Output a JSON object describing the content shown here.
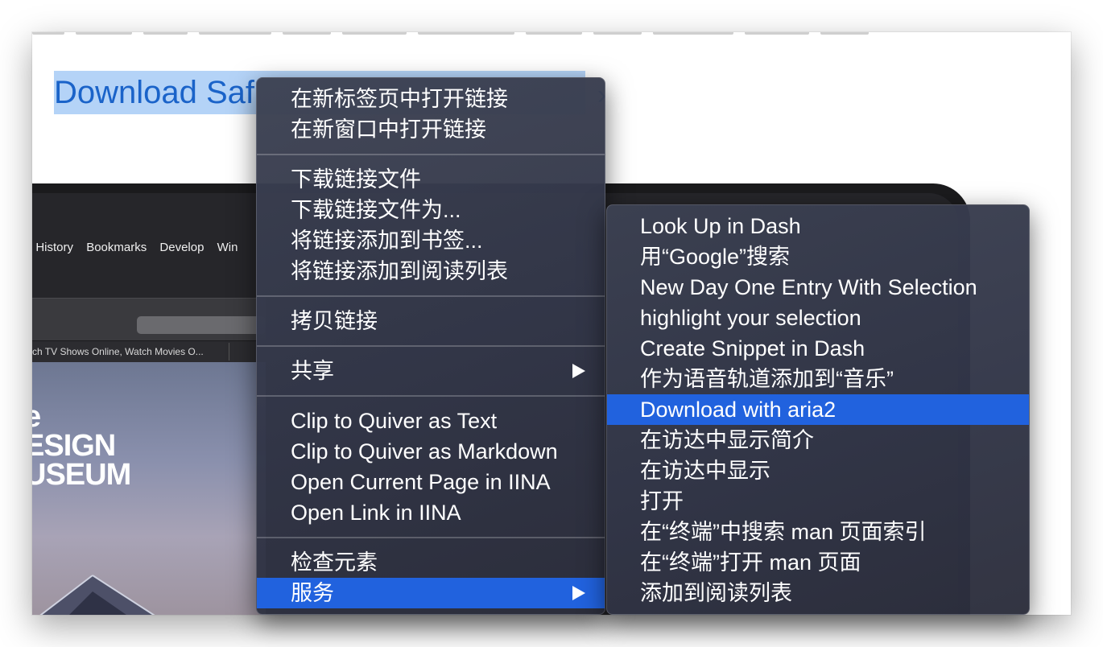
{
  "page": {
    "link_text": "Download Saf",
    "link_chevron": "›"
  },
  "laptop": {
    "menubar": [
      "History",
      "Bookmarks",
      "Develop",
      "Win"
    ],
    "tab_title": "atch TV Shows Online, Watch Movies O...",
    "logo_lines": [
      "e",
      "ESIGN",
      "USEUM"
    ]
  },
  "context_menu": {
    "items": [
      {
        "label": "在新标签页中打开链接"
      },
      {
        "label": "在新窗口中打开链接"
      },
      {
        "label": "下载链接文件"
      },
      {
        "label": "下载链接文件为..."
      },
      {
        "label": "将链接添加到书签..."
      },
      {
        "label": "将链接添加到阅读列表"
      },
      {
        "label": "拷贝链接"
      },
      {
        "label": "共享",
        "submenu": true
      },
      {
        "label": "Clip to Quiver as Text"
      },
      {
        "label": "Clip to Quiver as Markdown"
      },
      {
        "label": "Open Current Page in IINA"
      },
      {
        "label": "Open Link in IINA"
      },
      {
        "label": "检查元素"
      },
      {
        "label": "服务",
        "submenu": true,
        "highlighted": true
      }
    ]
  },
  "services_menu": {
    "items": [
      {
        "label": "Look Up in Dash"
      },
      {
        "label": "用“Google”搜索"
      },
      {
        "label": "New Day One Entry With Selection"
      },
      {
        "label": "highlight your selection"
      },
      {
        "label": "Create Snippet in Dash"
      },
      {
        "label": "作为语音轨道添加到“音乐”"
      },
      {
        "label": "Download with aria2",
        "highlighted": true
      },
      {
        "label": "在访达中显示简介"
      },
      {
        "label": "在访达中显示"
      },
      {
        "label": "打开"
      },
      {
        "label": "在“终端”中搜索 man 页面索引"
      },
      {
        "label": "在“终端”打开 man 页面"
      },
      {
        "label": "添加到阅读列表"
      }
    ]
  },
  "colors": {
    "highlight": "#2162de",
    "link": "#1a63c9",
    "selection": "#b4d3f7"
  }
}
